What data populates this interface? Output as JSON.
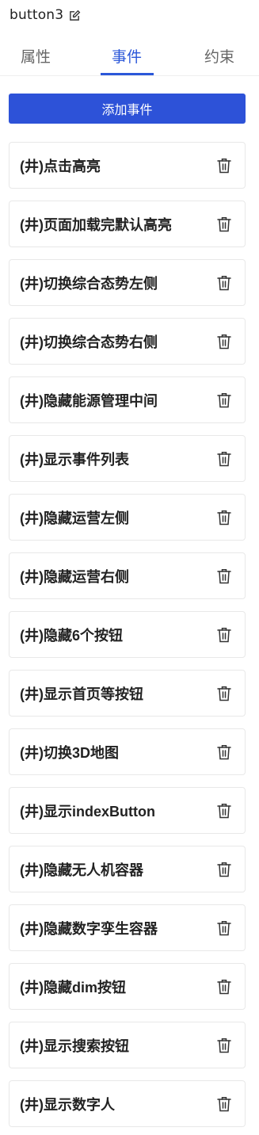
{
  "header": {
    "title": "button3",
    "edit_icon": "edit-icon"
  },
  "tabs": [
    {
      "label": "属性",
      "active": false
    },
    {
      "label": "事件",
      "active": true
    },
    {
      "label": "约束",
      "active": false
    }
  ],
  "accent_color": "#2b57d9",
  "add_button": {
    "label": "添加事件"
  },
  "events": [
    {
      "label": "(井)点击高亮"
    },
    {
      "label": "(井)页面加载完默认高亮"
    },
    {
      "label": "(井)切换综合态势左侧"
    },
    {
      "label": "(井)切换综合态势右侧"
    },
    {
      "label": "(井)隐藏能源管理中间"
    },
    {
      "label": "(井)显示事件列表"
    },
    {
      "label": "(井)隐藏运营左侧"
    },
    {
      "label": "(井)隐藏运营右侧"
    },
    {
      "label": "(井)隐藏6个按钮"
    },
    {
      "label": "(井)显示首页等按钮"
    },
    {
      "label": "(井)切换3D地图"
    },
    {
      "label": "(井)显示indexButton"
    },
    {
      "label": "(井)隐藏无人机容器"
    },
    {
      "label": "(井)隐藏数字孪生容器"
    },
    {
      "label": "(井)隐藏dim按钮"
    },
    {
      "label": "(井)显示搜索按钮"
    },
    {
      "label": "(井)显示数字人"
    }
  ],
  "item_icon": "trash-icon"
}
